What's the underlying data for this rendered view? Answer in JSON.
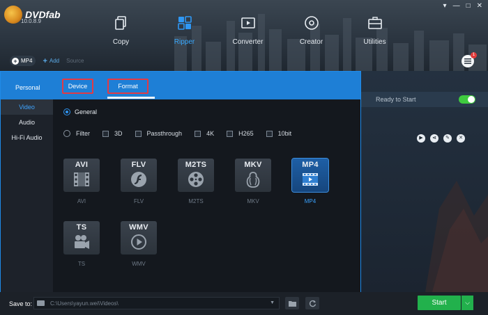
{
  "app": {
    "name": "DVDfab",
    "version": "10.0.8.9"
  },
  "window_controls": [
    "▾",
    "—",
    "□",
    "✕"
  ],
  "nav": {
    "items": [
      {
        "label": "Copy",
        "icon": "copy-icon"
      },
      {
        "label": "Ripper",
        "icon": "ripper-icon",
        "active": true
      },
      {
        "label": "Converter",
        "icon": "converter-icon"
      },
      {
        "label": "Creator",
        "icon": "creator-icon"
      },
      {
        "label": "Utilities",
        "icon": "utilities-icon"
      }
    ],
    "menu_badge": "1"
  },
  "subtool": {
    "profile": "MP4",
    "add_label": "Add",
    "third": "Source"
  },
  "panel": {
    "category": "Personal",
    "tabs": {
      "device": "Device",
      "format": "Format"
    },
    "side_items": [
      "Video",
      "Audio",
      "Hi-Fi Audio"
    ],
    "general_label": "General",
    "filter_label": "Filter",
    "filters": [
      "3D",
      "Passthrough",
      "4K",
      "H265",
      "10bit"
    ],
    "formats": [
      {
        "title": "AVI",
        "label": "AVI",
        "icon": "film-icon"
      },
      {
        "title": "FLV",
        "label": "FLV",
        "icon": "flash-icon"
      },
      {
        "title": "M2TS",
        "label": "M2TS",
        "icon": "reel-icon"
      },
      {
        "title": "MKV",
        "label": "MKV",
        "icon": "matryoshka-icon"
      },
      {
        "title": "MP4",
        "label": "MP4",
        "icon": "film-blue-icon",
        "active": true
      },
      {
        "title": "TS",
        "label": "TS",
        "icon": "camera-icon"
      },
      {
        "title": "WMV",
        "label": "WMV",
        "icon": "play-circle-icon"
      }
    ]
  },
  "task": {
    "status": "Ready to Start"
  },
  "bottom": {
    "save_label": "Save to:",
    "path": "C:\\Users\\yayun.wei\\Videos\\",
    "start": "Start"
  },
  "colors": {
    "accent": "#1e7fd6",
    "start": "#22b14c",
    "highlight": "#e23a44"
  }
}
